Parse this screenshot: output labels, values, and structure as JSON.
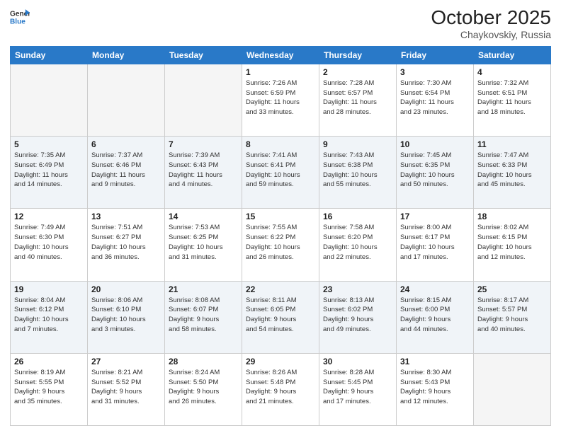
{
  "header": {
    "logo_general": "General",
    "logo_blue": "Blue",
    "month": "October 2025",
    "location": "Chaykovskiy, Russia"
  },
  "days_of_week": [
    "Sunday",
    "Monday",
    "Tuesday",
    "Wednesday",
    "Thursday",
    "Friday",
    "Saturday"
  ],
  "weeks": [
    [
      {
        "day": "",
        "info": ""
      },
      {
        "day": "",
        "info": ""
      },
      {
        "day": "",
        "info": ""
      },
      {
        "day": "1",
        "info": "Sunrise: 7:26 AM\nSunset: 6:59 PM\nDaylight: 11 hours\nand 33 minutes."
      },
      {
        "day": "2",
        "info": "Sunrise: 7:28 AM\nSunset: 6:57 PM\nDaylight: 11 hours\nand 28 minutes."
      },
      {
        "day": "3",
        "info": "Sunrise: 7:30 AM\nSunset: 6:54 PM\nDaylight: 11 hours\nand 23 minutes."
      },
      {
        "day": "4",
        "info": "Sunrise: 7:32 AM\nSunset: 6:51 PM\nDaylight: 11 hours\nand 18 minutes."
      }
    ],
    [
      {
        "day": "5",
        "info": "Sunrise: 7:35 AM\nSunset: 6:49 PM\nDaylight: 11 hours\nand 14 minutes."
      },
      {
        "day": "6",
        "info": "Sunrise: 7:37 AM\nSunset: 6:46 PM\nDaylight: 11 hours\nand 9 minutes."
      },
      {
        "day": "7",
        "info": "Sunrise: 7:39 AM\nSunset: 6:43 PM\nDaylight: 11 hours\nand 4 minutes."
      },
      {
        "day": "8",
        "info": "Sunrise: 7:41 AM\nSunset: 6:41 PM\nDaylight: 10 hours\nand 59 minutes."
      },
      {
        "day": "9",
        "info": "Sunrise: 7:43 AM\nSunset: 6:38 PM\nDaylight: 10 hours\nand 55 minutes."
      },
      {
        "day": "10",
        "info": "Sunrise: 7:45 AM\nSunset: 6:35 PM\nDaylight: 10 hours\nand 50 minutes."
      },
      {
        "day": "11",
        "info": "Sunrise: 7:47 AM\nSunset: 6:33 PM\nDaylight: 10 hours\nand 45 minutes."
      }
    ],
    [
      {
        "day": "12",
        "info": "Sunrise: 7:49 AM\nSunset: 6:30 PM\nDaylight: 10 hours\nand 40 minutes."
      },
      {
        "day": "13",
        "info": "Sunrise: 7:51 AM\nSunset: 6:27 PM\nDaylight: 10 hours\nand 36 minutes."
      },
      {
        "day": "14",
        "info": "Sunrise: 7:53 AM\nSunset: 6:25 PM\nDaylight: 10 hours\nand 31 minutes."
      },
      {
        "day": "15",
        "info": "Sunrise: 7:55 AM\nSunset: 6:22 PM\nDaylight: 10 hours\nand 26 minutes."
      },
      {
        "day": "16",
        "info": "Sunrise: 7:58 AM\nSunset: 6:20 PM\nDaylight: 10 hours\nand 22 minutes."
      },
      {
        "day": "17",
        "info": "Sunrise: 8:00 AM\nSunset: 6:17 PM\nDaylight: 10 hours\nand 17 minutes."
      },
      {
        "day": "18",
        "info": "Sunrise: 8:02 AM\nSunset: 6:15 PM\nDaylight: 10 hours\nand 12 minutes."
      }
    ],
    [
      {
        "day": "19",
        "info": "Sunrise: 8:04 AM\nSunset: 6:12 PM\nDaylight: 10 hours\nand 7 minutes."
      },
      {
        "day": "20",
        "info": "Sunrise: 8:06 AM\nSunset: 6:10 PM\nDaylight: 10 hours\nand 3 minutes."
      },
      {
        "day": "21",
        "info": "Sunrise: 8:08 AM\nSunset: 6:07 PM\nDaylight: 9 hours\nand 58 minutes."
      },
      {
        "day": "22",
        "info": "Sunrise: 8:11 AM\nSunset: 6:05 PM\nDaylight: 9 hours\nand 54 minutes."
      },
      {
        "day": "23",
        "info": "Sunrise: 8:13 AM\nSunset: 6:02 PM\nDaylight: 9 hours\nand 49 minutes."
      },
      {
        "day": "24",
        "info": "Sunrise: 8:15 AM\nSunset: 6:00 PM\nDaylight: 9 hours\nand 44 minutes."
      },
      {
        "day": "25",
        "info": "Sunrise: 8:17 AM\nSunset: 5:57 PM\nDaylight: 9 hours\nand 40 minutes."
      }
    ],
    [
      {
        "day": "26",
        "info": "Sunrise: 8:19 AM\nSunset: 5:55 PM\nDaylight: 9 hours\nand 35 minutes."
      },
      {
        "day": "27",
        "info": "Sunrise: 8:21 AM\nSunset: 5:52 PM\nDaylight: 9 hours\nand 31 minutes."
      },
      {
        "day": "28",
        "info": "Sunrise: 8:24 AM\nSunset: 5:50 PM\nDaylight: 9 hours\nand 26 minutes."
      },
      {
        "day": "29",
        "info": "Sunrise: 8:26 AM\nSunset: 5:48 PM\nDaylight: 9 hours\nand 21 minutes."
      },
      {
        "day": "30",
        "info": "Sunrise: 8:28 AM\nSunset: 5:45 PM\nDaylight: 9 hours\nand 17 minutes."
      },
      {
        "day": "31",
        "info": "Sunrise: 8:30 AM\nSunset: 5:43 PM\nDaylight: 9 hours\nand 12 minutes."
      },
      {
        "day": "",
        "info": ""
      }
    ]
  ]
}
